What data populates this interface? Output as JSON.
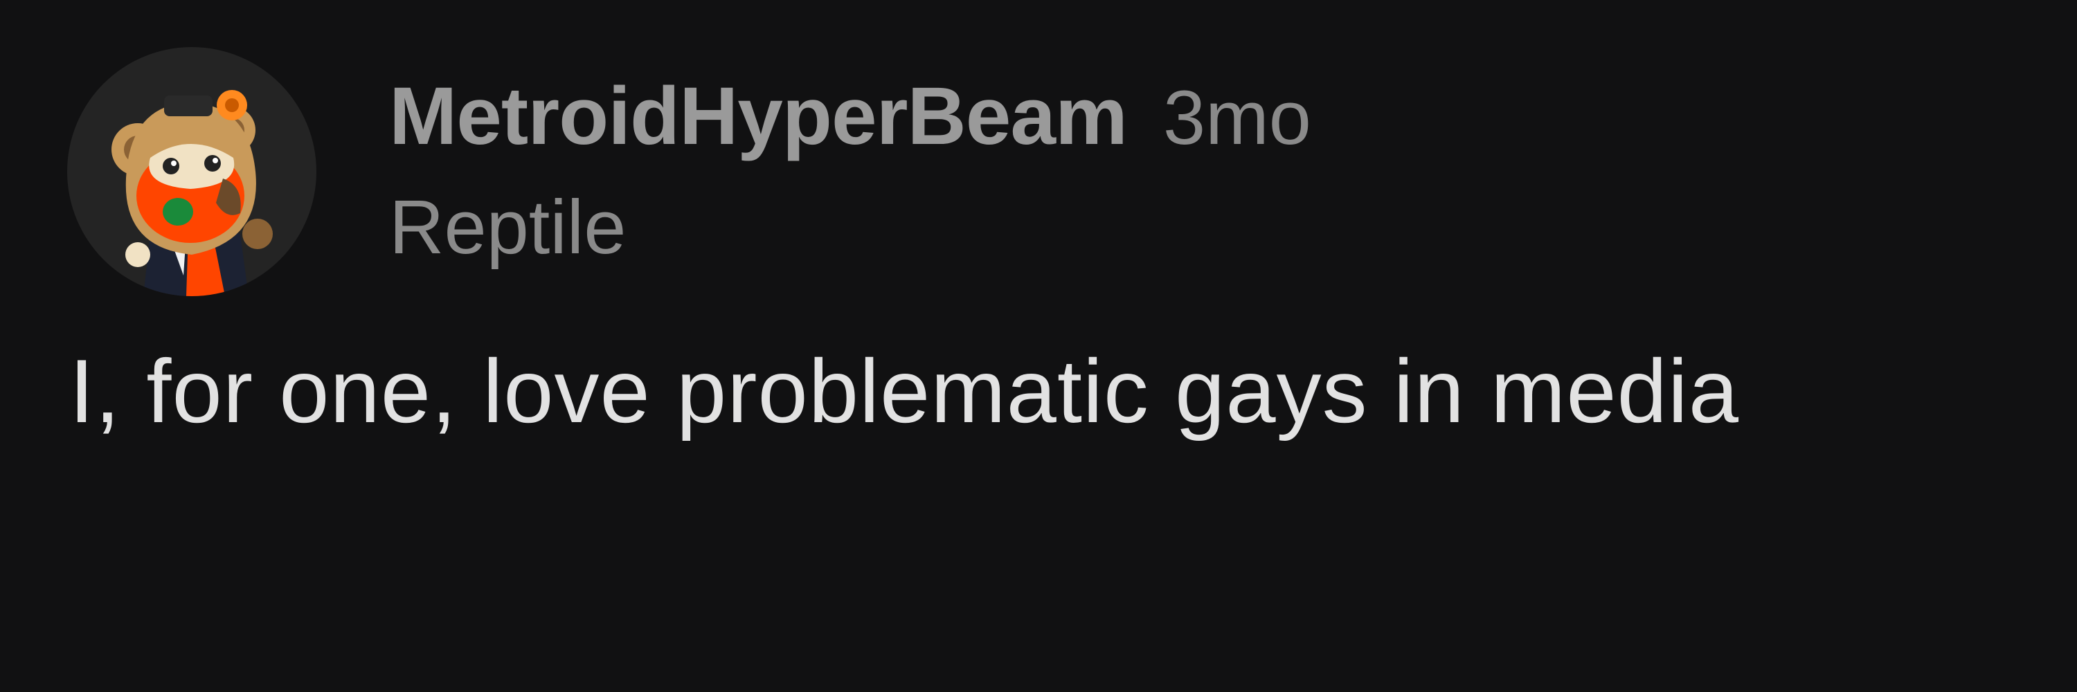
{
  "comment": {
    "author": {
      "username": "MetroidHyperBeam",
      "flair": "Reptile",
      "avatar_icon": "snoo-avatar-icon"
    },
    "timestamp": "3mo",
    "body": "I, for one, love problematic gays in media"
  },
  "colors": {
    "background": "#111112",
    "username": "#9a9a9a",
    "meta": "#8a8a8a",
    "body_text": "#e2e2e2",
    "avatar_orange": "#ff4500"
  }
}
